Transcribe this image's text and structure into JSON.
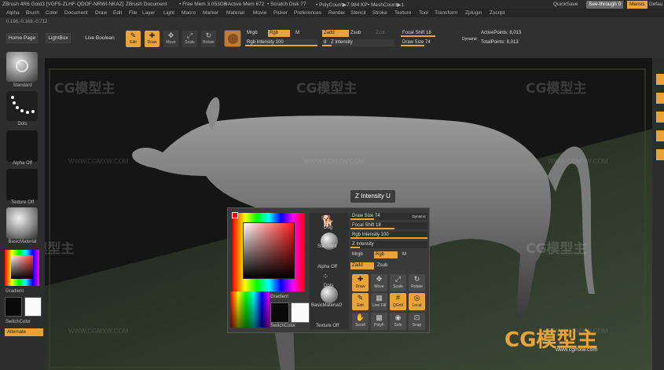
{
  "window": {
    "title": "ZBrush 4R6 Gold3 [VGF5-ZLHF-QDOF-NRWI-NKAZ]",
    "document": "ZBrush Document",
    "stats": [
      "• Free Mem 3.053GB",
      "• Active Mem 672",
      "• Scratch Disk 77",
      "• PolyCount▶7.984 KP",
      "• MeshCount▶1"
    ],
    "quicksave": "QuickSave",
    "see_through": "See-through 0",
    "menus": "Menus",
    "default": "Defau"
  },
  "menubar": [
    "Alpha",
    "Brush",
    "Color",
    "Document",
    "Draw",
    "Edit",
    "File",
    "Layer",
    "Light",
    "Macro",
    "Marker",
    "Material",
    "Movie",
    "Picker",
    "Preferences",
    "Render",
    "Stencil",
    "Stroke",
    "Texture",
    "Tool",
    "Transform",
    "Zplugin",
    "Zscript"
  ],
  "coords": "0.196,-0.168,-0.712",
  "top_shelf": {
    "home_page": "Home Page",
    "lightbox": "LightBox",
    "live_boolean": "Live Boolean",
    "tools": [
      {
        "label": "Edit",
        "icon": "edit-icon",
        "on": true
      },
      {
        "label": "Draw",
        "icon": "draw-icon",
        "on": true
      },
      {
        "label": "Move",
        "icon": "move-icon",
        "on": false
      },
      {
        "label": "Scale",
        "icon": "scale-icon",
        "on": false
      },
      {
        "label": "Rotate",
        "icon": "rotate-icon",
        "on": false
      }
    ],
    "mrgb": "Mrgb",
    "rgb": "Rgb",
    "m": "M",
    "rgb_intensity": "Rgb Intensity 100",
    "zadd": "Zadd",
    "zsub": "Zsub",
    "zcut": "Zcut",
    "z_intensity": "Z Intensity",
    "z_intensity_value": "8",
    "focal_shift": "Focal Shift 18",
    "draw_size": "Draw Size 74",
    "dynamic": "Dynamic",
    "active_points": "ActivePoints: 8,013",
    "total_points": "TotalPoints: 8,013"
  },
  "left_shelf": {
    "standard": "Standard",
    "dots": "Dots",
    "alpha_off": "Alpha Off",
    "texture_off": "Texture Off",
    "basic_material": "BasicMaterial",
    "gradient": "Gradient",
    "switch_color": "SwitchColor",
    "alternate": "Alternate"
  },
  "viewport": {
    "z_intensity_label": "Z Intensity  U"
  },
  "popup": {
    "dog": "Dog",
    "standard": "Standard",
    "alpha_off": "Alpha Off",
    "dots": "Dots",
    "basic_material": "BasicMaterial2",
    "gradient": "Gradient",
    "switch_color": "SwitchColor",
    "texture_off": "Texture Off",
    "draw_size": "Draw Size 74",
    "dynamic": "Dynamic",
    "focal_shift": "Focal Shift 18",
    "rgb_intensity": "Rgb Intensity 100",
    "z_intensity": "Z Intensity",
    "mrgb": "Mrgb",
    "rgb": "Rgb",
    "m": "M",
    "zadd": "Zadd",
    "zsub": "Zsub",
    "tools_row1": [
      "Draw",
      "Move",
      "Scale",
      "Rotate"
    ],
    "tools_row2": [
      "Edit",
      "Line Fill",
      "QGrid",
      "Local"
    ],
    "tools_row3": [
      "Scroll",
      "PolyF",
      "Solo",
      "Snap"
    ]
  },
  "watermarks": [
    "CG模型主",
    "WWW.CGMXW.COM",
    "www.cgmxw.com"
  ],
  "colors": {
    "accent": "#e8a33a",
    "panel": "#303030",
    "viewport": "#141414"
  }
}
